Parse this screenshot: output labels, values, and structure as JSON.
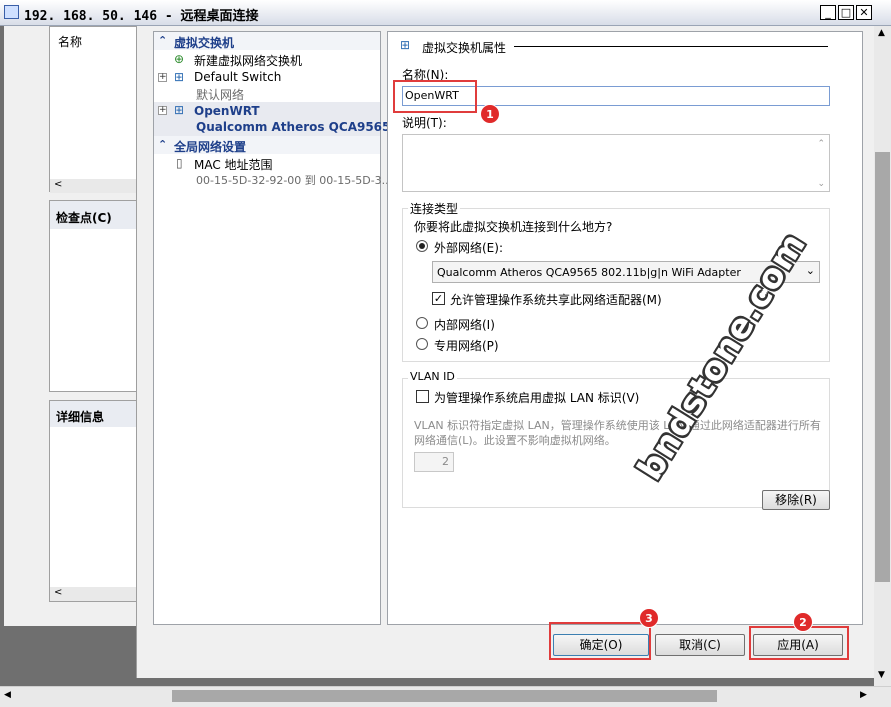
{
  "window": {
    "title": "192. 168. 50. 146 - 远程桌面连接",
    "minimize": "_",
    "restore": "□",
    "close": "✕"
  },
  "background_panels": {
    "name_header": "名称",
    "checkpoint_header": "检查点(C)",
    "details_header": "详细信息"
  },
  "tree": {
    "section_virtual_switch": "虚拟交换机",
    "new_switch": "新建虚拟网络交换机",
    "default_switch": "Default Switch",
    "default_switch_sub": "默认网络",
    "openwrt": "OpenWRT",
    "openwrt_sub": "Qualcomm Atheros QCA9565 ...",
    "section_global": "全局网络设置",
    "mac_range": "MAC 地址范围",
    "mac_range_sub": "00-15-5D-32-92-00 到 00-15-5D-3..."
  },
  "props": {
    "title": "虚拟交换机属性",
    "name_label": "名称(N):",
    "name_value": "OpenWRT",
    "desc_label": "说明(T):",
    "conn_type_title": "连接类型",
    "conn_question": "你要将此虚拟交换机连接到什么地方?",
    "external_label": "外部网络(E):",
    "adapter_selected": "Qualcomm Atheros QCA9565 802.11b|g|n WiFi Adapter",
    "allow_share_label": "允许管理操作系统共享此网络适配器(M)",
    "internal_label": "内部网络(I)",
    "private_label": "专用网络(P)",
    "vlan_title": "VLAN ID",
    "vlan_enable_label": "为管理操作系统启用虚拟 LAN 标识(V)",
    "vlan_desc": "VLAN 标识符指定虚拟 LAN，管理操作系统使用该 LAN 通过此网络适配器进行所有网络通信(L)。此设置不影响虚拟机网络。",
    "vlan_value": "2",
    "remove_button": "移除(R)"
  },
  "buttons": {
    "ok": "确定(O)",
    "cancel": "取消(C)",
    "apply": "应用(A)"
  },
  "annotations": {
    "badge1": "1",
    "badge2": "2",
    "badge3": "3"
  },
  "watermark": "bndstone.com",
  "colors": {
    "accent_red": "#e03c3c",
    "tree_header_blue": "#1e3f8a"
  }
}
